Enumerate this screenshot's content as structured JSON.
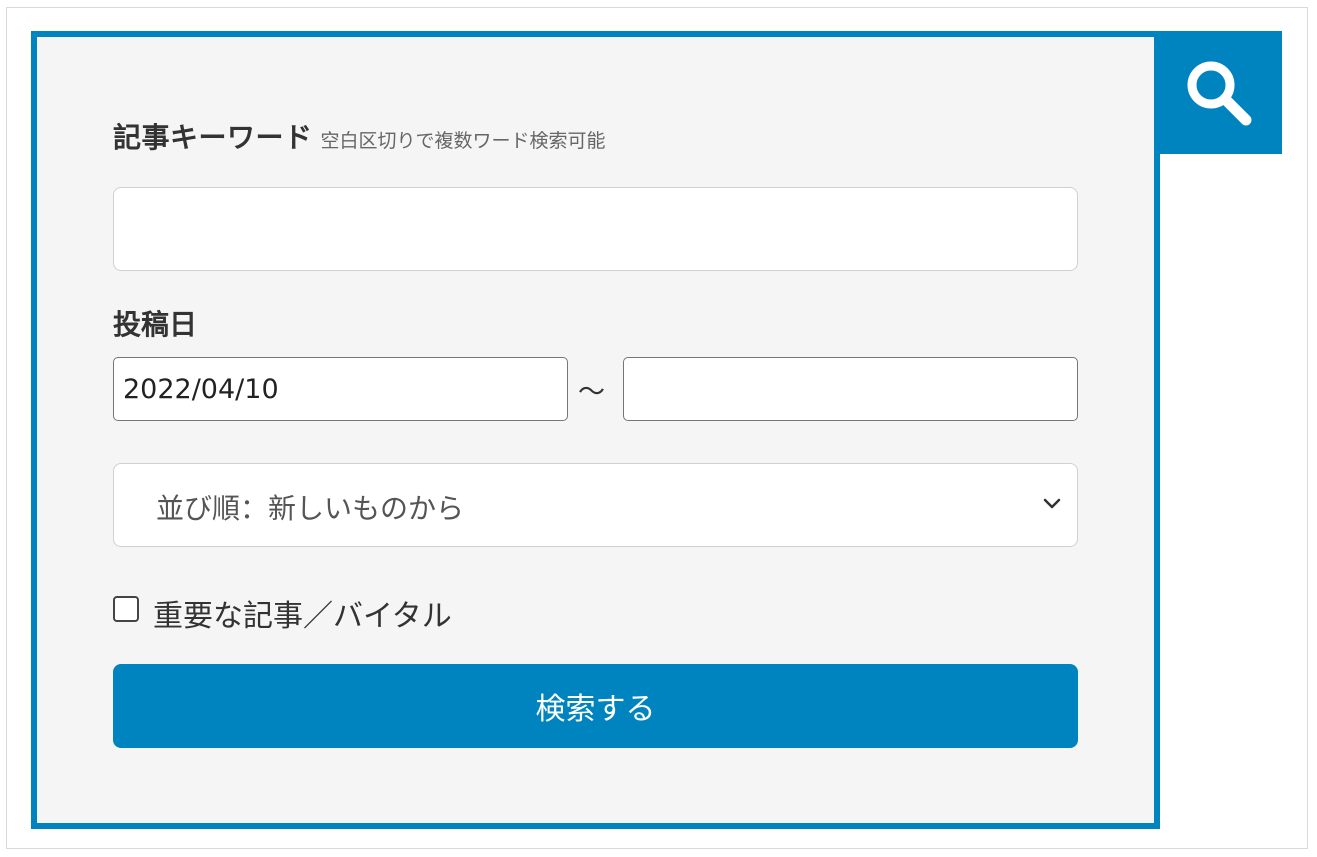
{
  "search": {
    "icon": "search-icon",
    "keyword": {
      "label": "記事キーワード",
      "hint": "空白区切りで複数ワード検索可能",
      "value": "",
      "placeholder": ""
    },
    "date": {
      "label": "投稿日",
      "from_value": "2022/04/10",
      "separator": "～",
      "to_value": ""
    },
    "sort": {
      "selected": "並び順：新しいものから",
      "icon": "chevron-down-icon"
    },
    "important_checkbox": {
      "label": "重要な記事／バイタル",
      "checked": false
    },
    "submit_label": "検索する"
  },
  "colors": {
    "accent": "#0084c0",
    "panel_background": "#f5f5f5",
    "text": "#333333"
  }
}
